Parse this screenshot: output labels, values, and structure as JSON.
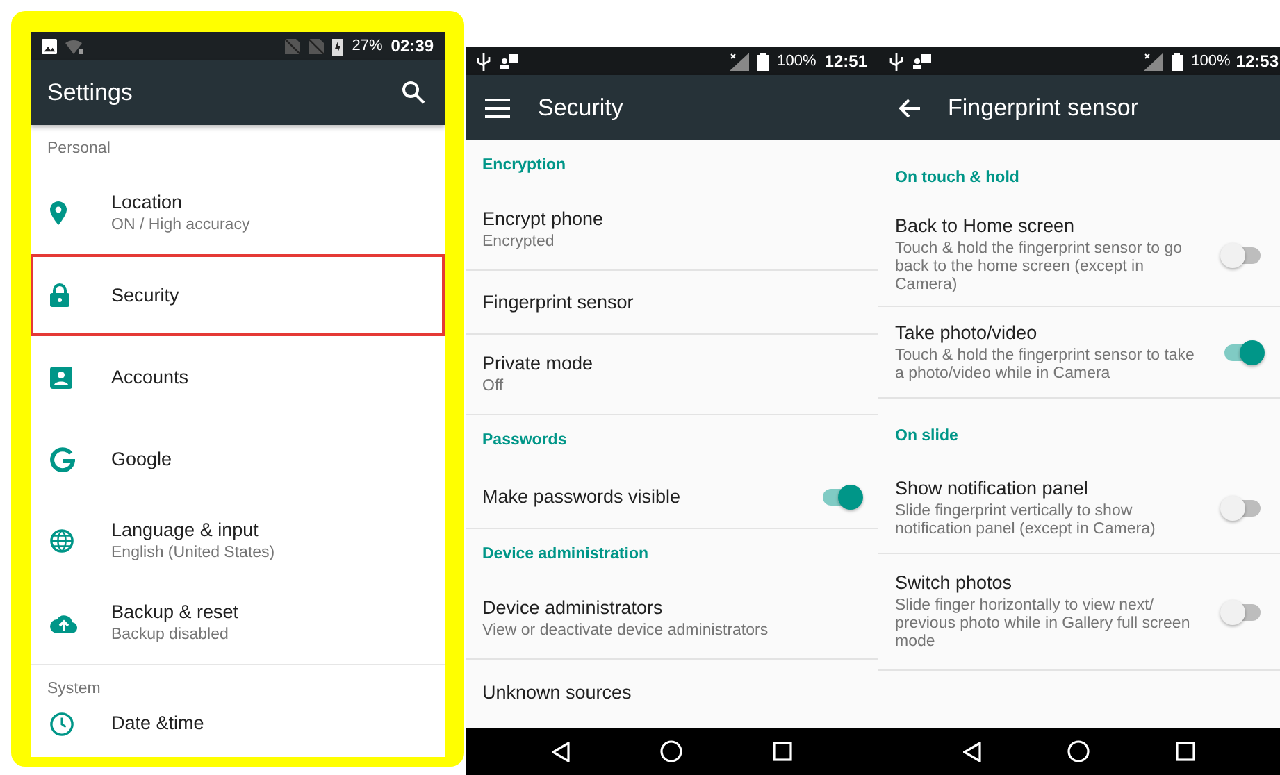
{
  "screens": [
    {
      "highlighted": true,
      "status": {
        "battery": "27%",
        "time": "02:39"
      },
      "toolbar": {
        "title": "Settings",
        "search": true
      },
      "nav_bar": false,
      "items": [
        {
          "kind": "header",
          "title": "Personal",
          "accent": false
        },
        {
          "kind": "entry",
          "title": "Location",
          "subtitle": "ON / High accuracy",
          "highlighted": false
        },
        {
          "kind": "entry",
          "title": "Security",
          "highlighted": true
        },
        {
          "kind": "entry",
          "title": "Accounts",
          "highlighted": false
        },
        {
          "kind": "entry",
          "title": "Google",
          "highlighted": false
        },
        {
          "kind": "entry",
          "title": "Language & input",
          "subtitle": "English (United States)",
          "highlighted": false
        },
        {
          "kind": "entry",
          "title": "Backup & reset",
          "subtitle": "Backup disabled",
          "highlighted": false
        },
        {
          "kind": "header",
          "title": "System",
          "accent": false
        },
        {
          "kind": "entry",
          "title": "Date &time",
          "highlighted": false
        }
      ]
    },
    {
      "highlighted": false,
      "status": {
        "battery": "100%",
        "time": "12:51"
      },
      "toolbar": {
        "title": "Security",
        "search": false
      },
      "nav_bar": true,
      "items": [
        {
          "kind": "header",
          "title": "Encryption",
          "accent": true
        },
        {
          "kind": "entry",
          "title": "Encrypt phone",
          "subtitle": "Encrypted"
        },
        {
          "kind": "entry",
          "title": "Fingerprint sensor"
        },
        {
          "kind": "entry",
          "title": "Private mode",
          "subtitle": "Off"
        },
        {
          "kind": "header",
          "title": "Passwords",
          "accent": true
        },
        {
          "kind": "switch",
          "title": "Make passwords visible",
          "on": true
        },
        {
          "kind": "header",
          "title": "Device administration",
          "accent": true
        },
        {
          "kind": "entry",
          "title": "Device administrators",
          "subtitle": "View or deactivate device administrators"
        },
        {
          "kind": "entry",
          "title": "Unknown sources"
        }
      ]
    },
    {
      "highlighted": false,
      "status": {
        "battery": "100%",
        "time": "12:53"
      },
      "toolbar": {
        "title": "Fingerprint sensor",
        "search": false
      },
      "nav_bar": true,
      "items": [
        {
          "kind": "header",
          "title": "On touch & hold",
          "accent": true
        },
        {
          "kind": "switch",
          "title": "Back to Home screen",
          "subtitle": "Touch & hold the fingerprint sensor to go back to the home screen (except in Camera)",
          "on": false
        },
        {
          "kind": "switch",
          "title": "Take photo/video",
          "subtitle": "Touch & hold the fingerprint sensor to take a photo/video while in Camera",
          "on": true
        },
        {
          "kind": "header",
          "title": "On slide",
          "accent": true
        },
        {
          "kind": "switch",
          "title": "Show notification panel",
          "subtitle": "Slide fingerprint vertically to show notification panel (except in Camera)",
          "on": false
        },
        {
          "kind": "switch",
          "title": "Switch photos",
          "subtitle": "Slide finger horizontally to view next/ previous photo while in Gallery full screen mode",
          "on": false
        }
      ]
    }
  ]
}
